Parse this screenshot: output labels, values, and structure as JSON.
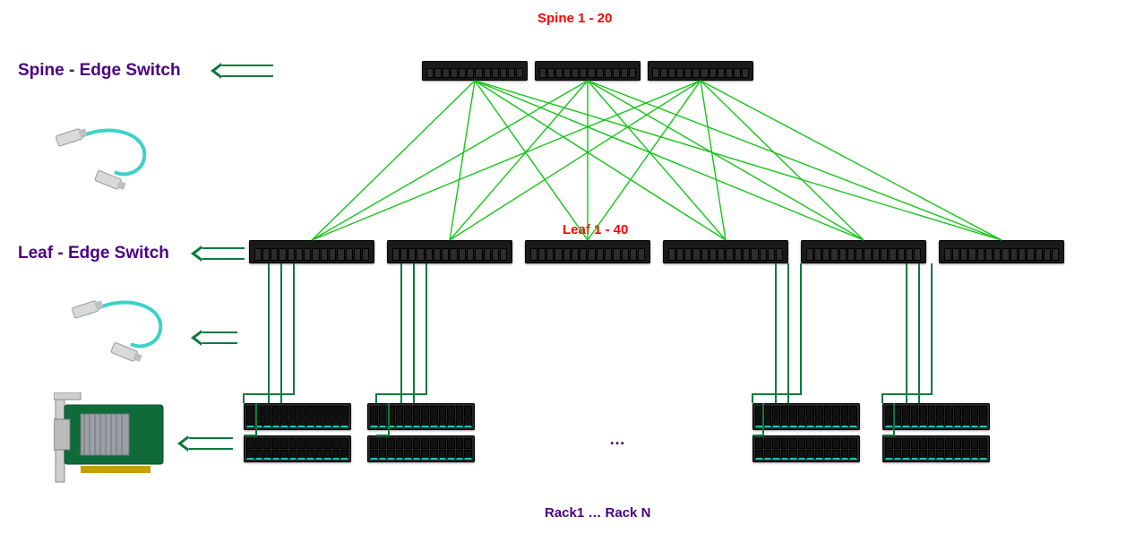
{
  "labels": {
    "spine_title": "Spine 1 - 20",
    "leaf_title": "Leaf 1 - 40",
    "spine_edge": "Spine  - Edge Switch",
    "leaf_edge": "Leaf - Edge Switch",
    "racks": "Rack1 …  Rack N",
    "ellipsis": "…"
  },
  "topology": {
    "spine_switch_count": 3,
    "leaf_switch_count": 6,
    "server_group_count": 4,
    "servers_per_group": 2,
    "spine_range": "1 - 20",
    "leaf_range": "1 - 40"
  },
  "colors": {
    "link_green": "#17c41a",
    "dark_green": "#0a7a3b",
    "label_purple": "#4b0082",
    "label_red": "#ff0000",
    "device_black": "#1a1a1a"
  }
}
